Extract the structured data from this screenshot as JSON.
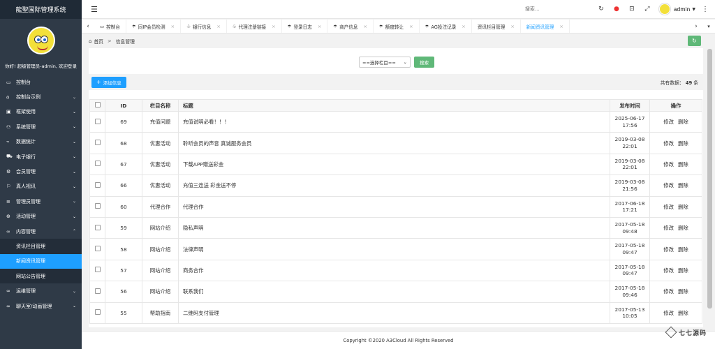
{
  "app": {
    "title": "龍聖国际管理系统",
    "welcome": "你好!  超级管理员-admin, 欢迎登录"
  },
  "sidebar": {
    "items": [
      {
        "icon": "monitor-icon",
        "glyph": "▭",
        "label": "控制台",
        "expandable": false
      },
      {
        "icon": "home-icon",
        "glyph": "⌂",
        "label": "控制台示例",
        "expandable": true
      },
      {
        "icon": "layout-icon",
        "glyph": "▣",
        "label": "框架使用",
        "expandable": true
      },
      {
        "icon": "user-icon",
        "glyph": "⚇",
        "label": "系统管理",
        "expandable": true
      },
      {
        "icon": "stats-icon",
        "glyph": "⌁",
        "label": "数据统计",
        "expandable": true
      },
      {
        "icon": "car-icon",
        "glyph": "⛟",
        "label": "电子银行",
        "expandable": true
      },
      {
        "icon": "gear-icon",
        "glyph": "⚙",
        "label": "会员管理",
        "expandable": true
      },
      {
        "icon": "live-icon",
        "glyph": "⚐",
        "label": "真人视讯",
        "expandable": true
      },
      {
        "icon": "list-icon",
        "glyph": "≡",
        "label": "管理员管理",
        "expandable": true
      },
      {
        "icon": "activity-icon",
        "glyph": "⊕",
        "label": "活动管理",
        "expandable": true
      },
      {
        "icon": "content-icon",
        "glyph": "∞",
        "label": "内容管理",
        "expandable": true,
        "open": true
      }
    ],
    "sub_items": [
      {
        "label": "资讯栏目管理",
        "active": false
      },
      {
        "label": "新闻资讯管理",
        "active": true
      },
      {
        "label": "网站公告管理",
        "active": false
      }
    ],
    "items_after": [
      {
        "icon": "ops-icon",
        "glyph": "∞",
        "label": "运维管理",
        "expandable": true
      },
      {
        "icon": "chat-icon",
        "glyph": "∞",
        "label": "聊天室/动画管理",
        "expandable": true
      }
    ]
  },
  "topbar": {
    "search_placeholder": "搜索...",
    "username": "admin"
  },
  "tabs": [
    {
      "label": "控制台",
      "icon": "▭",
      "closable": false,
      "active": false
    },
    {
      "label": "同IP会员检测",
      "icon": "☂",
      "closable": true,
      "active": false
    },
    {
      "label": "银行信息",
      "icon": "♧",
      "closable": true,
      "active": false
    },
    {
      "label": "代理注册链接",
      "icon": "♧",
      "closable": true,
      "active": false
    },
    {
      "label": "登录日志",
      "icon": "☂",
      "closable": true,
      "active": false
    },
    {
      "label": "商户信息",
      "icon": "☂",
      "closable": true,
      "active": false
    },
    {
      "label": "额度转让",
      "icon": "☂",
      "closable": true,
      "active": false
    },
    {
      "label": "AG投注记录",
      "icon": "☂",
      "closable": true,
      "active": false
    },
    {
      "label": "资讯栏目管理",
      "icon": "",
      "closable": true,
      "active": false
    },
    {
      "label": "新闻资讯管理",
      "icon": "",
      "closable": true,
      "active": true
    }
  ],
  "breadcrumb": {
    "home": "首页",
    "sep": ">",
    "current": "信息管理"
  },
  "filter": {
    "select_value": "==选择栏目==",
    "search_button": "搜索"
  },
  "toolbar": {
    "add_button": "添加信息",
    "total_prefix": "共有数据：",
    "total_count": "49",
    "total_suffix": "条"
  },
  "table": {
    "headers": {
      "id": "ID",
      "category": "栏目名称",
      "title": "标题",
      "time": "发布时间",
      "ops": "操作"
    },
    "edit_label": "修改",
    "delete_label": "删除",
    "rows": [
      {
        "id": "69",
        "category": "充值问题",
        "title": "充值说明必看！！！",
        "date": "2025-06-17",
        "time": "17:56"
      },
      {
        "id": "68",
        "category": "优惠活动",
        "title": "聆听会员的声音 真诚服务会员",
        "date": "2019-03-08",
        "time": "22:01"
      },
      {
        "id": "67",
        "category": "优惠活动",
        "title": "下载APP赠送彩金",
        "date": "2019-03-08",
        "time": "22:01"
      },
      {
        "id": "66",
        "category": "优惠活动",
        "title": "充值三连送 彩金送不停",
        "date": "2019-03-08",
        "time": "21:56"
      },
      {
        "id": "60",
        "category": "代理合作",
        "title": "代理合作",
        "date": "2017-06-18",
        "time": "17:21"
      },
      {
        "id": "59",
        "category": "网站介绍",
        "title": "隐私声明",
        "date": "2017-05-18",
        "time": "09:48"
      },
      {
        "id": "58",
        "category": "网站介绍",
        "title": "法律声明",
        "date": "2017-05-18",
        "time": "09:47"
      },
      {
        "id": "57",
        "category": "网站介绍",
        "title": "商务合作",
        "date": "2017-05-18",
        "time": "09:47"
      },
      {
        "id": "56",
        "category": "网站介绍",
        "title": "联系我们",
        "date": "2017-05-18",
        "time": "09:46"
      },
      {
        "id": "55",
        "category": "帮助指南",
        "title": "二维码支付管理",
        "date": "2017-05-13",
        "time": "10:05"
      }
    ]
  },
  "footer": {
    "copyright": "Copyright ©2020 A3Cloud All Rights Reserved"
  },
  "watermark": {
    "text": "七七源码"
  }
}
